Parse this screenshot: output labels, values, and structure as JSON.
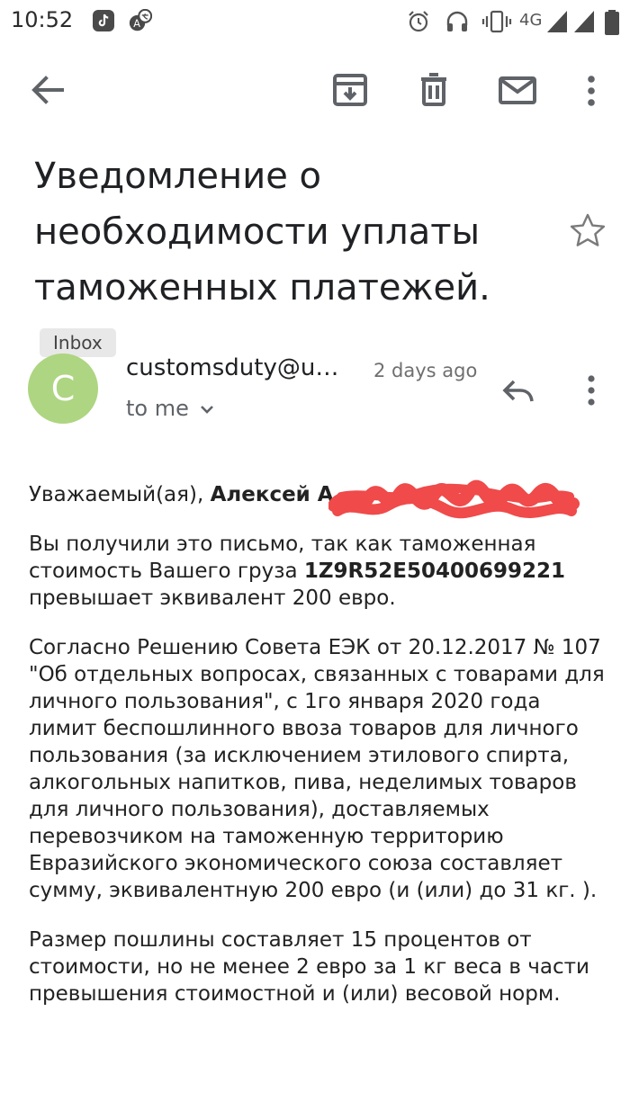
{
  "status_bar": {
    "time": "10:52",
    "network": "4G",
    "left_icons": [
      "tiktok-icon",
      "translate-icon"
    ],
    "right_icons": [
      "alarm-icon",
      "headset-icon",
      "vibrate-icon",
      "signal-icon",
      "battery-icon"
    ]
  },
  "toolbar": {
    "icons": [
      "back-arrow-icon",
      "archive-icon",
      "trash-icon",
      "mail-icon",
      "more-vert-icon"
    ]
  },
  "subject": {
    "text": "Уведомление о необходимости уплаты таможенных платежей.",
    "label": "Inbox"
  },
  "sender": {
    "avatar_letter": "C",
    "avatar_color": "#aed581",
    "email": "customsduty@u…",
    "time": "2 days ago",
    "recipient": "to me"
  },
  "body": {
    "greeting_prefix": "Уважаемый(ая), ",
    "greeting_name": "Алексей А",
    "p1_before": "Вы получили это письмо, так как таможенная стоимость Вашего груза ",
    "tracking_number": "1Z9R52E50400699221",
    "p1_after": " превышает эквивалент 200 евро.",
    "p2": "Согласно Решению Совета ЕЭК от 20.12.2017 № 107 \"Об отдельных вопросах, связанных с товарами для личного пользования\", с 1го января 2020 года лимит беспошлинного ввоза товаров для личного пользования (за исключением этилового спирта, алкогольных напитков, пива, неделимых товаров для личного пользования), доставляемых перевозчиком на таможенную территорию Евразийского экономического союза составляет сумму, эквивалентную 200 евро (и (или) до 31 кг. ).",
    "p3": "Размер пошлины составляет 15 процентов от стоимости, но не менее 2 евро за 1 кг веса в части превышения стоимостной и (или) весовой норм."
  },
  "colors": {
    "redaction": "#f04a4a",
    "icon": "#5f6368"
  }
}
